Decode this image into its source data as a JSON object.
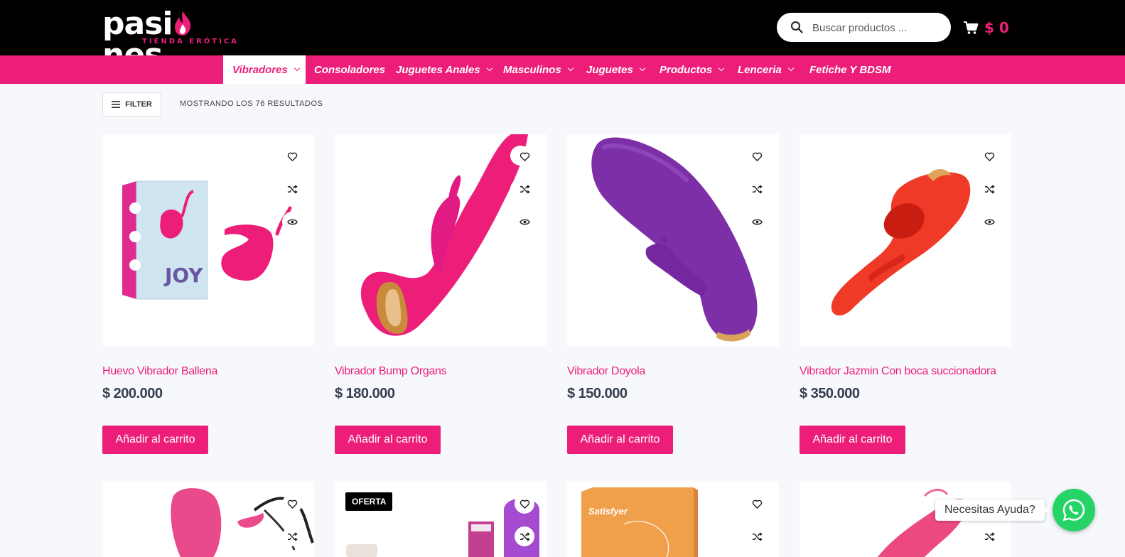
{
  "brand": {
    "logo_text_before": "pasi",
    "logo_text_flame": "☗",
    "logo_text_after": "nes",
    "logo_tagline": "TIENDA ERÓTICA",
    "accent_color": "#ec1e79"
  },
  "search": {
    "placeholder": "Buscar productos ..."
  },
  "cart": {
    "total": "$ 0"
  },
  "nav": [
    {
      "label": "Vibradores",
      "has_dropdown": true,
      "active": true
    },
    {
      "label": "Consoladores",
      "has_dropdown": false
    },
    {
      "label": "Juguetes Anales",
      "has_dropdown": true
    },
    {
      "label": "Masculinos",
      "has_dropdown": true
    },
    {
      "label": "Juguetes",
      "has_dropdown": true
    },
    {
      "label": "Productos",
      "has_dropdown": true
    },
    {
      "label": "Lenceria",
      "has_dropdown": true
    },
    {
      "label": "Fetiche Y BDSM",
      "has_dropdown": false
    }
  ],
  "toolbar": {
    "filter_label": "FILTER",
    "results_text": "MOSTRANDO LOS 76 RESULTADOS"
  },
  "products": [
    {
      "title": "Huevo Vibrador Ballena",
      "price": "$ 200.000",
      "button": "Añadir al carrito",
      "box_label": "JOY"
    },
    {
      "title": "Vibrador Bump Organs",
      "price": "$ 180.000",
      "button": "Añadir al carrito"
    },
    {
      "title": "Vibrador Doyola",
      "price": "$ 150.000",
      "button": "Añadir al carrito"
    },
    {
      "title": "Vibrador Jazmin Con boca succionadora",
      "price": "$ 350.000",
      "button": "Añadir al carrito"
    }
  ],
  "second_row": [
    {
      "badge": ""
    },
    {
      "badge": "OFERTA"
    },
    {
      "badge": "",
      "box_label": "Satisfyer"
    },
    {
      "badge": ""
    }
  ],
  "help": {
    "label": "Necesitas Ayuda?"
  }
}
